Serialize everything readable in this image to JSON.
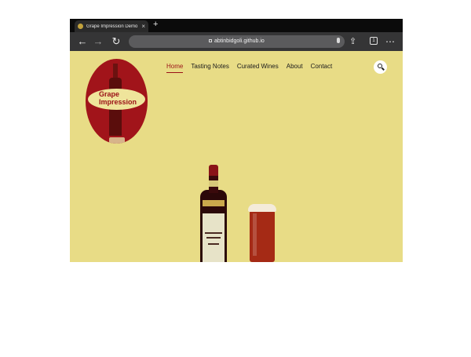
{
  "browser": {
    "tab_title": "Grape Impression Demo",
    "url": "abtinbidgoli.github.io",
    "tab_count": "1",
    "icons": {
      "back": "arrow-left-icon",
      "forward": "arrow-right-icon",
      "reload": "reload-icon",
      "share": "share-icon",
      "tabs": "tab-switcher-icon",
      "more": "more-dots-icon",
      "mic": "microphone-icon",
      "lock": "lock-icon"
    }
  },
  "site": {
    "logo_text": [
      "Grape",
      "Impression"
    ],
    "nav": [
      "Home",
      "Tasting Notes",
      "Curated Wines",
      "About",
      "Contact"
    ],
    "active_nav": "Home",
    "colors": {
      "page_bg": "#e8dc86",
      "accent": "#9a1016",
      "logo_bg": "#a1141a"
    }
  }
}
